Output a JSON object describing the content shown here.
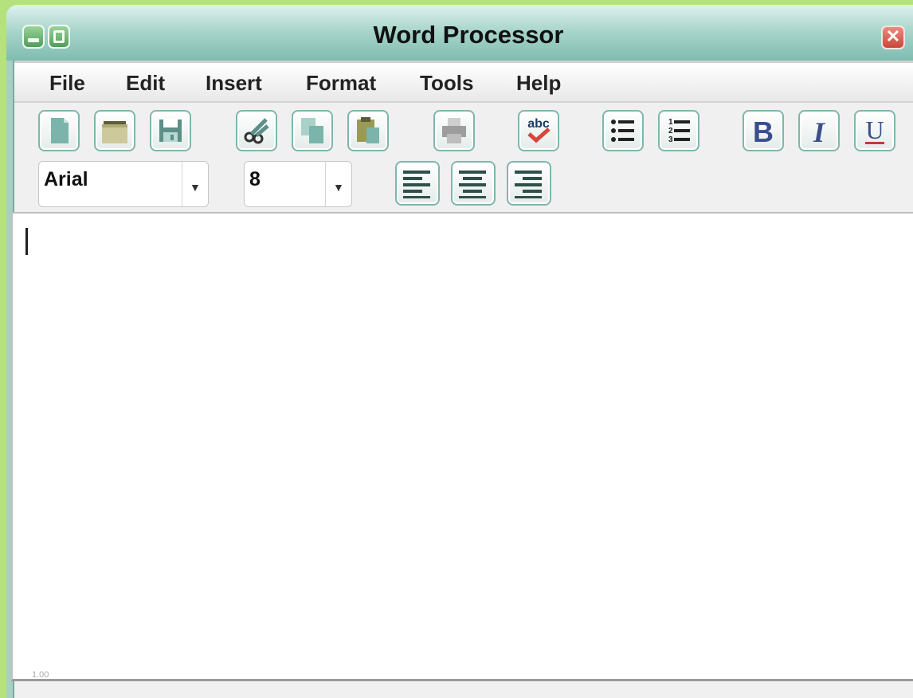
{
  "window": {
    "title": "Word Processor",
    "close_glyph": "✕"
  },
  "menu": {
    "items": [
      "File",
      "Edit",
      "Insert",
      "Format",
      "Tools",
      "Help"
    ]
  },
  "toolbar": {
    "buttons": [
      {
        "name": "new-document-button",
        "icon": "new-document-icon"
      },
      {
        "name": "open-folder-button",
        "icon": "folder-icon"
      },
      {
        "name": "save-button",
        "icon": "floppy-disk-icon"
      },
      {
        "name": "cut-button",
        "icon": "scissors-icon"
      },
      {
        "name": "copy-button",
        "icon": "copy-icon"
      },
      {
        "name": "paste-button",
        "icon": "clipboard-icon"
      },
      {
        "name": "print-button",
        "icon": "printer-icon"
      },
      {
        "name": "spell-check-button",
        "icon": "spellcheck-icon",
        "label": "abc"
      },
      {
        "name": "bulleted-list-button",
        "icon": "bullet-list-icon"
      },
      {
        "name": "numbered-list-button",
        "icon": "numbered-list-icon"
      },
      {
        "name": "bold-button",
        "icon": "bold-icon",
        "label": "B"
      },
      {
        "name": "italic-button",
        "icon": "italic-icon",
        "label": "I"
      },
      {
        "name": "underline-button",
        "icon": "underline-icon",
        "label": "U"
      }
    ],
    "font_family": "Arial",
    "font_size": "8",
    "dropdown_arrow": "▼",
    "align_buttons": [
      "align-left-button",
      "align-center-button",
      "align-right-button"
    ],
    "numbered_digits": [
      "1",
      "2",
      "3"
    ]
  },
  "colors": {
    "accent": "#7fb6ac",
    "icon_teal": "#7ab4aa",
    "icon_olive": "#9a9a55",
    "spell_red": "#d9453c",
    "underline_red": "#c2393a",
    "text_blue": "#3a4f8a"
  },
  "status": {
    "zoom": "1.00"
  }
}
